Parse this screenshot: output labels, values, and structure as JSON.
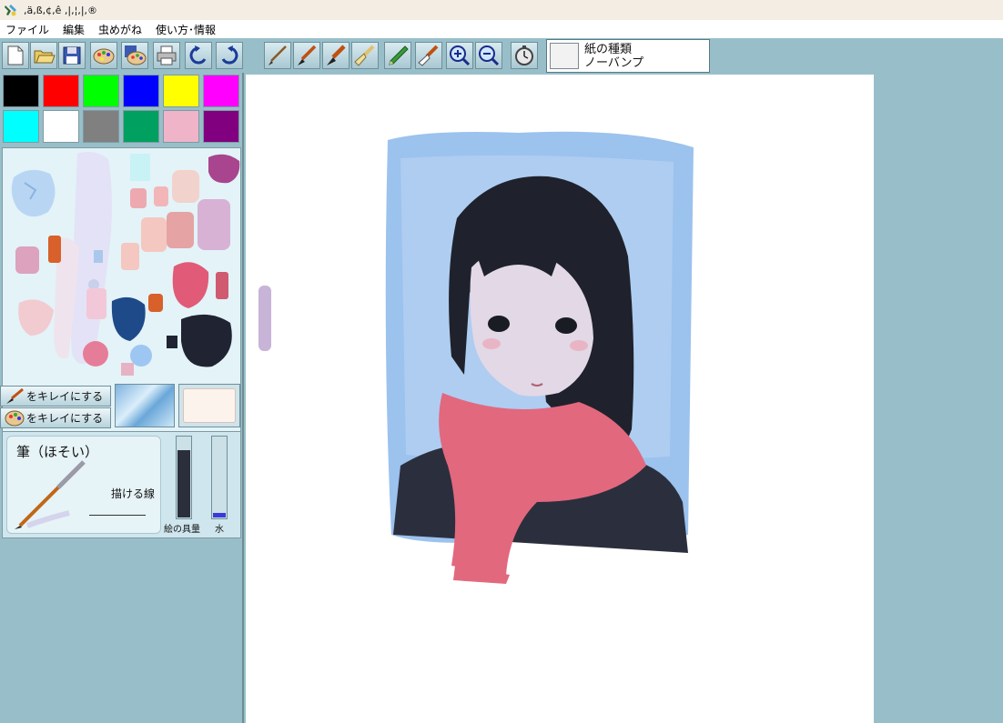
{
  "window": {
    "title": ",ä,ß,¢,ê ,|,¦,|,®"
  },
  "menu": {
    "items": [
      "ファイル",
      "編集",
      "虫めがね",
      "使い方･情報"
    ]
  },
  "toolbar": {
    "file_buttons": [
      {
        "icon": "new-file-icon"
      },
      {
        "icon": "open-folder-icon"
      },
      {
        "icon": "save-icon"
      },
      {
        "icon": "palette-open-icon"
      },
      {
        "icon": "palette-save-icon"
      },
      {
        "icon": "print-icon"
      },
      {
        "icon": "undo-icon"
      },
      {
        "icon": "redo-icon"
      }
    ],
    "tool_buttons": [
      {
        "icon": "fine-brush-icon"
      },
      {
        "icon": "medium-brush-icon"
      },
      {
        "icon": "thick-brush-icon"
      },
      {
        "icon": "flat-brush-icon"
      },
      {
        "icon": "pencil-icon"
      },
      {
        "icon": "eraser-brush-icon"
      },
      {
        "icon": "zoom-in-icon"
      },
      {
        "icon": "zoom-out-icon"
      },
      {
        "icon": "timer-icon"
      }
    ],
    "paper": {
      "label": "紙の種類",
      "value": "ノーバンプ"
    }
  },
  "palette": {
    "colors": [
      "#000000",
      "#ff0000",
      "#00ff00",
      "#0000ff",
      "#ffff00",
      "#ff00ff",
      "#00ffff",
      "#ffffff",
      "#808080",
      "#00a060",
      "#f0b4c8",
      "#800080"
    ]
  },
  "mixing_tray": {
    "clean_brush_label": "をキレイにする",
    "clean_palette_label": "をキレイにする"
  },
  "brush": {
    "name": "筆（ほそい）",
    "line_label": "描ける線",
    "paint_meter_label": "絵の具量",
    "water_meter_label": "水",
    "paint_amount": 0.82,
    "water_amount": 0.06
  },
  "colors": {
    "background": "#98bfc9",
    "paper": "#ffffff",
    "paint_fill": "#2b2f3b",
    "water_fill": "#3a3ad8"
  }
}
